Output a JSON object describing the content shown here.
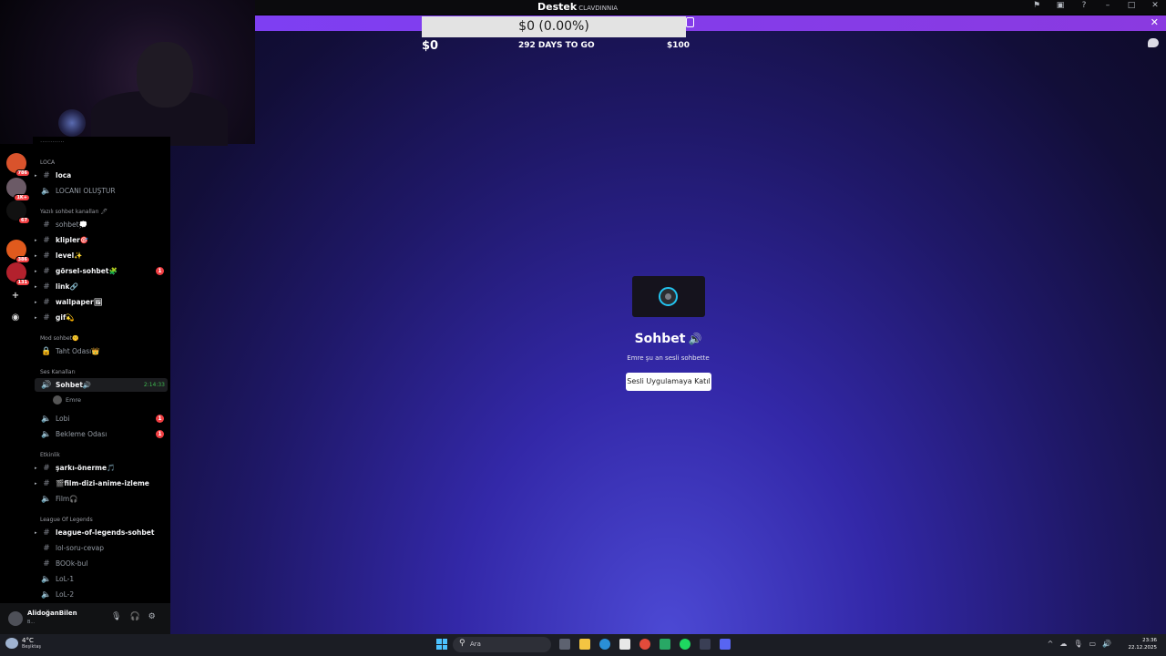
{
  "window": {
    "title_main": "Destek",
    "title_sub": "CLAVDINNIA"
  },
  "donation": {
    "progress_text": "$0 (0.00%)",
    "current": "$0",
    "days_left": "292 DAYS TO GO",
    "goal": "$100",
    "progress_fraction": 0
  },
  "stage": {
    "channel_name": "Sohbet",
    "subtitle": "Emre şu an sesli sohbette",
    "join_button": "Sesli Uygulamaya Katıl"
  },
  "servers": [
    {
      "badge": "786"
    },
    {
      "badge": "1K+"
    },
    {
      "badge": "67"
    },
    {
      "badge": "386"
    },
    {
      "badge": "131"
    }
  ],
  "channel_list": {
    "cut_top": "············",
    "categories": {
      "loca": "LOCA",
      "text": "Yazılı sohbet kanalları 🖊",
      "mod": "Mod sohbet🤫",
      "voice": "Ses Kanalları",
      "events": "Etkinlik",
      "lol": "League Of Legends"
    },
    "channels": {
      "loca": "loca",
      "loca_create": "LOCANI OLUŞTUR",
      "sohbet": "sohbet💭",
      "klipler": "klipler🎯",
      "level": "level✨",
      "gorsel": "görsel-sohbet🧩",
      "gorsel_badge": "1",
      "link": "link🔗",
      "wallpaper": "wallpaper🖼",
      "gif": "gif💫",
      "taht": "Taht Odası👑",
      "sohbet_voice": "Sohbet🔊",
      "sohbet_voice_time": "2:14:33",
      "voice_user": "Emre",
      "lobi": "Lobi",
      "lobi_badge": "1",
      "bekleme": "Bekleme Odası",
      "bekleme_badge": "1",
      "sarki": "şarkı-önerme🎵",
      "film_dizi": "🎬film-dizi-anime-izleme",
      "film": "Film🎧",
      "lol_sohbet": "league-of-legends-sohbet",
      "lol_soru": "lol-soru-cevap",
      "boook": "BOOk-bul",
      "lol1": "LoL-1",
      "lol2": "LoL-2"
    }
  },
  "user": {
    "name": "AlidoğanBilen",
    "status": "B..."
  },
  "taskbar": {
    "temp": "4°C",
    "location": "Beşiktaş",
    "search_placeholder": "Ara",
    "time": "23:36",
    "date": "22.12.2025"
  },
  "colors": {
    "banner": "#8a3ae0",
    "accent_green": "#3fb950",
    "badge_red": "#f23f43"
  }
}
